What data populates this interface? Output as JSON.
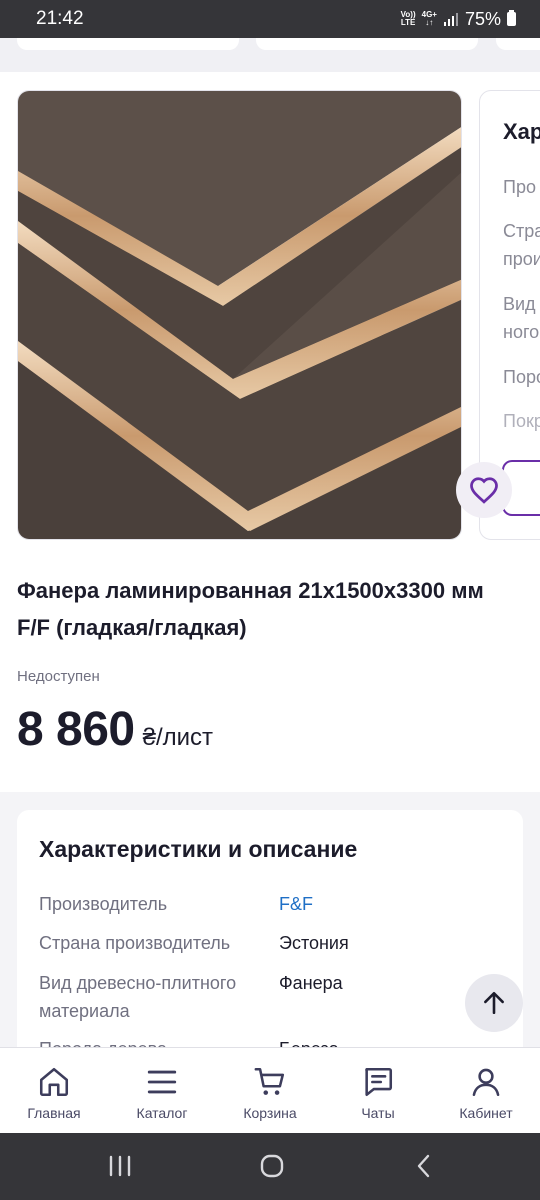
{
  "status_bar": {
    "time": "21:42",
    "volte": "Vo)) LTE",
    "network": "4G+",
    "battery_percent": "75%"
  },
  "product": {
    "title": "Фанера ламинированная 21x1500x3300 мм F/F (гладкая/гладкая)",
    "availability": "Недоступен",
    "price_value": "8 860",
    "price_unit": "₴/лист",
    "image_alt": "laminated plywood sheets",
    "favorite_icon": "heart-icon"
  },
  "peek_card": {
    "title": "Хар",
    "rows": [
      "Про",
      "Стра",
      "прои",
      "Вид",
      "ного",
      "Поро",
      "Покр"
    ]
  },
  "specs": {
    "heading": "Характеристики и описание",
    "rows": [
      {
        "label": "Производитель",
        "value": "F&F"
      },
      {
        "label": "Страна производитель",
        "value": "Эстония"
      },
      {
        "label": "Вид древесно-плитного материала",
        "value": "Фанера"
      },
      {
        "label": "Порода дерева",
        "value": "Береза"
      }
    ]
  },
  "bottom_nav": {
    "items": [
      {
        "label": "Главная",
        "icon": "home-icon"
      },
      {
        "label": "Каталог",
        "icon": "menu-icon"
      },
      {
        "label": "Корзина",
        "icon": "cart-icon"
      },
      {
        "label": "Чаты",
        "icon": "chat-icon"
      },
      {
        "label": "Кабинет",
        "icon": "user-icon"
      }
    ]
  },
  "colors": {
    "accent_purple": "#6a2ea8",
    "link_blue": "#1f6fc6",
    "text_dark": "#1c1c2b",
    "text_muted": "#707080"
  }
}
